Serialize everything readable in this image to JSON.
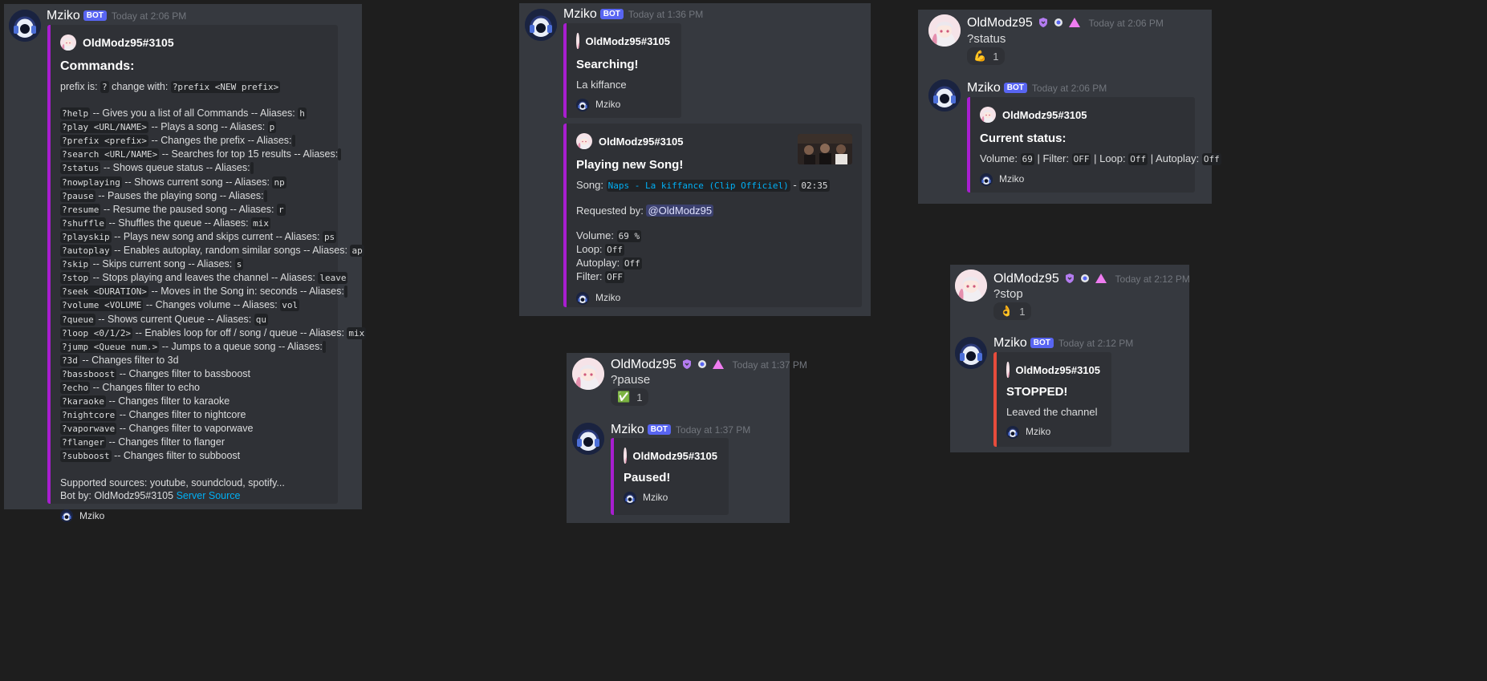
{
  "colors": {
    "background": "#1e1e1e",
    "panel": "#36393f",
    "embed": "#2f3136",
    "embed_accent": "#a81ed0",
    "embed_accent_red": "#e74c3c",
    "bot_badge": "#5865f2",
    "link": "#00aff4"
  },
  "bot": {
    "name": "Mziko",
    "badge": "BOT",
    "footer_name": "Mziko"
  },
  "user": {
    "name": "OldModz95",
    "tag": "OldModz95#3105"
  },
  "help_message": {
    "timestamp": "Today at 2:06 PM",
    "embed_author": "OldModz95#3105",
    "title": "Commands:",
    "prefix_line": {
      "text1": "prefix is:",
      "prefix": "?",
      "text2": "change with:",
      "change_cmd": "?prefix <NEW prefix>"
    },
    "commands": [
      {
        "cmd": "?help",
        "desc": "-- Gives you a list of all Commands -- Aliases:",
        "alias": "h"
      },
      {
        "cmd": "?play <URL/NAME>",
        "desc": "-- Plays a song -- Aliases:",
        "alias": "p"
      },
      {
        "cmd": "?prefix <prefix>",
        "desc": "-- Changes the prefix -- Aliases:",
        "alias": " "
      },
      {
        "cmd": "?search <URL/NAME>",
        "desc": "-- Searches for top 15 results -- Aliases:",
        "alias": " "
      },
      {
        "cmd": "?status",
        "desc": "-- Shows queue status -- Aliases:",
        "alias": " "
      },
      {
        "cmd": "?nowplaying",
        "desc": "-- Shows current song -- Aliases:",
        "alias": "np"
      },
      {
        "cmd": "?pause",
        "desc": "-- Pauses the playing song -- Aliases:",
        "alias": " "
      },
      {
        "cmd": "?resume",
        "desc": "-- Resume the paused song -- Aliases:",
        "alias": "r"
      },
      {
        "cmd": "?shuffle",
        "desc": "-- Shuffles the queue -- Aliases:",
        "alias": "mix"
      },
      {
        "cmd": "?playskip",
        "desc": "-- Plays new song and skips current -- Aliases:",
        "alias": "ps"
      },
      {
        "cmd": "?autoplay",
        "desc": "-- Enables autoplay, random similar songs -- Aliases:",
        "alias": "ap"
      },
      {
        "cmd": "?skip",
        "desc": "-- Skips current song -- Aliases:",
        "alias": "s"
      },
      {
        "cmd": "?stop",
        "desc": "-- Stops playing and leaves the channel -- Aliases:",
        "alias": "leave"
      },
      {
        "cmd": "?seek <DURATION>",
        "desc": "-- Moves in the Song in: seconds -- Aliases:",
        "alias": " "
      },
      {
        "cmd": "?volume <VOLUME",
        "desc": "-- Changes volume -- Aliases:",
        "alias": "vol"
      },
      {
        "cmd": "?queue",
        "desc": "-- Shows current Queue -- Aliases:",
        "alias": "qu"
      },
      {
        "cmd": "?loop <0/1/2>",
        "desc": "-- Enables loop for off / song / queue -- Aliases:",
        "alias": "mix"
      },
      {
        "cmd": "?jump <Queue num.>",
        "desc": "-- Jumps to a queue song -- Aliases:",
        "alias": " "
      },
      {
        "cmd": "?3d",
        "desc": "-- Changes filter to 3d",
        "alias": ""
      },
      {
        "cmd": "?bassboost",
        "desc": "-- Changes filter to bassboost",
        "alias": ""
      },
      {
        "cmd": "?echo",
        "desc": "-- Changes filter to echo",
        "alias": ""
      },
      {
        "cmd": "?karaoke",
        "desc": "-- Changes filter to karaoke",
        "alias": ""
      },
      {
        "cmd": "?nightcore",
        "desc": "-- Changes filter to nightcore",
        "alias": ""
      },
      {
        "cmd": "?vaporwave",
        "desc": "-- Changes filter to vaporwave",
        "alias": ""
      },
      {
        "cmd": "?flanger",
        "desc": "-- Changes filter to flanger",
        "alias": ""
      },
      {
        "cmd": "?subboost",
        "desc": "-- Changes filter to subboost",
        "alias": ""
      }
    ],
    "sources": "Supported sources: youtube, soundcloud, spotify...",
    "bot_by": "Bot by: OldModz95#3105",
    "server_link": "Server",
    "source_link": "Source"
  },
  "search_message": {
    "timestamp": "Today at 1:36 PM",
    "searching": {
      "author": "OldModz95#3105",
      "title": "Searching!",
      "desc": "La kiffance"
    },
    "playing": {
      "author": "OldModz95#3105",
      "title": "Playing new Song!",
      "song_label": "Song:",
      "song": "Naps - La kiffance (Clip Officiel)",
      "sep": "-",
      "duration": "02:35",
      "requested_label": "Requested by:",
      "requested_by": "@OldModz95",
      "volume_label": "Volume:",
      "volume": "69 %",
      "loop_label": "Loop:",
      "loop": "Off",
      "autoplay_label": "Autoplay:",
      "autoplay": "Off",
      "filter_label": "Filter:",
      "filter": "OFF"
    }
  },
  "status_message": {
    "user_timestamp": "Today at 2:06 PM",
    "command": "?status",
    "reaction": {
      "emoji": "💪",
      "count": "1"
    },
    "bot_timestamp": "Today at 2:06 PM",
    "embed": {
      "author": "OldModz95#3105",
      "title": "Current status:",
      "volume_label": "Volume:",
      "volume": "69",
      "filter_label": "| Filter:",
      "filter": "OFF",
      "loop_label": "| Loop:",
      "loop": "Off",
      "autoplay_label": "| Autoplay:",
      "autoplay": "Off"
    }
  },
  "pause_message": {
    "user_timestamp": "Today at 1:37 PM",
    "command": "?pause",
    "reaction": {
      "emoji": "✅",
      "count": "1"
    },
    "bot_timestamp": "Today at 1:37 PM",
    "embed": {
      "author": "OldModz95#3105",
      "title": "Paused!"
    }
  },
  "stop_message": {
    "user_timestamp": "Today at 2:12 PM",
    "command": "?stop",
    "reaction": {
      "emoji": "👌",
      "count": "1"
    },
    "bot_timestamp": "Today at 2:12 PM",
    "embed": {
      "author": "OldModz95#3105",
      "title": "STOPPED!",
      "desc": "Leaved the channel"
    }
  }
}
